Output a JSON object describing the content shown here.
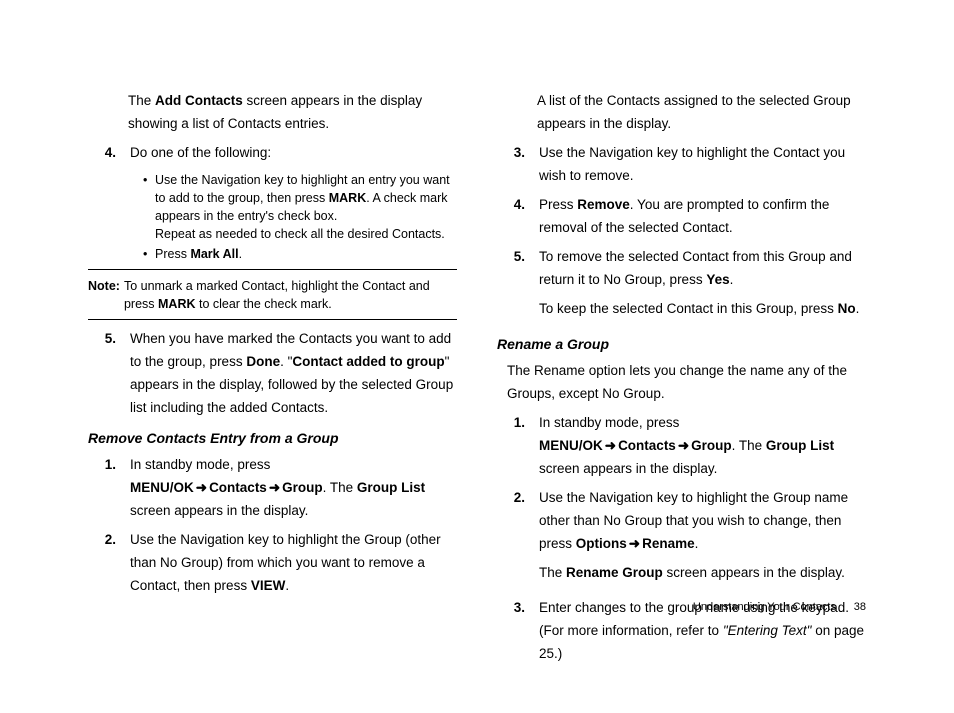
{
  "left": {
    "p1_a": "The ",
    "p1_b": "Add Contacts",
    "p1_c": " screen appears in the display showing a list of Contacts entries.",
    "s4n": "4.",
    "s4t": "Do one of the following:",
    "b1_a": "Use the Navigation key to highlight an entry you want to add to the group, then press ",
    "b1_b": "MARK",
    "b1_c": ". A check mark appears in the entry's check box.",
    "b1_d": "Repeat as needed to check all the desired Contacts.",
    "b2_a": "Press ",
    "b2_b": "Mark All",
    "b2_c": ".",
    "note_l": "Note:",
    "note_a": "To unmark a marked Contact, highlight the Contact and press ",
    "note_b": "MARK",
    "note_c": " to clear the check mark.",
    "s5n": "5.",
    "s5_a": "When you have marked the Contacts you want to add to the group, press ",
    "s5_b": "Done",
    "s5_c": ". \"",
    "s5_d": "Contact added to group",
    "s5_e": "\" appears in the display, followed by the selected Group list including the added Contacts.",
    "h1": "Remove Contacts Entry from a Group",
    "r1n": "1.",
    "r1_a": "In standby mode, press ",
    "r1_b": "MENU/OK",
    "r1_c": "Contacts",
    "r1_d": "Group",
    "r1_e": ". The ",
    "r1_f": "Group List",
    "r1_g": " screen appears in the display.",
    "r2n": "2.",
    "r2_a": "Use the Navigation key to highlight the Group (other than No Group) from which you want to remove a Contact, then press ",
    "r2_b": "VIEW",
    "r2_c": "."
  },
  "right": {
    "p1": "A list of the Contacts assigned to the selected Group appears in the display.",
    "s3n": "3.",
    "s3t": "Use the Navigation key to highlight the Contact you wish to remove.",
    "s4n": "4.",
    "s4_a": "Press ",
    "s4_b": "Remove",
    "s4_c": ". You are prompted to confirm the removal of the selected Contact.",
    "s5n": "5.",
    "s5_a": "To remove the selected Contact from this Group and return it to No Group, press ",
    "s5_b": "Yes",
    "s5_c": ".",
    "s5_d": "To keep the selected Contact in this Group, press ",
    "s5_e": "No",
    "s5_f": ".",
    "h2": "Rename a Group",
    "rn_intro": "The Rename option lets you change the name any of the Groups, except No Group.",
    "g1n": "1.",
    "g1_a": "In standby mode, press ",
    "g1_b": "MENU/OK",
    "g1_c": "Contacts",
    "g1_d": "Group",
    "g1_e": ". The ",
    "g1_f": "Group List",
    "g1_g": " screen appears in the display.",
    "g2n": "2.",
    "g2_a": "Use the Navigation key to highlight the Group name other than No Group that you wish to change, then press ",
    "g2_b": "Options",
    "g2_c": "Rename",
    "g2_d": ".",
    "g2_e": "The ",
    "g2_f": "Rename Group",
    "g2_g": " screen appears in the display.",
    "g3n": "3.",
    "g3_a": "Enter changes to the group name using the keypad. (For more information, refer to ",
    "g3_b": "\"Entering Text\"",
    "g3_c": "  on page 25.)"
  },
  "arrow": "➜",
  "footer_t": "Understanding Your Contacts",
  "footer_p": "38"
}
